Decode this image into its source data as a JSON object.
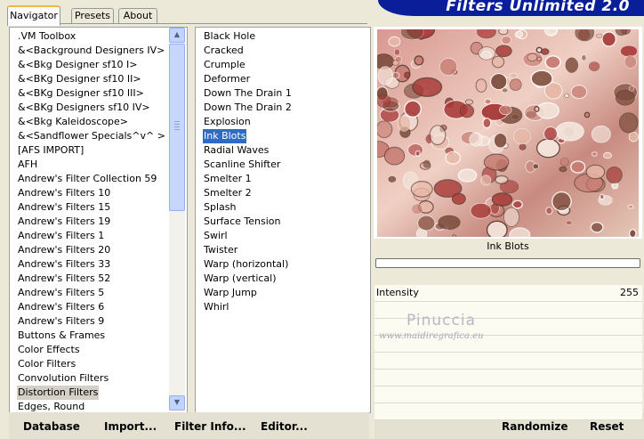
{
  "tabs": [
    "Navigator",
    "Presets",
    "About"
  ],
  "banner": "Filters Unlimited 2.0",
  "categories": [
    ".VM Toolbox",
    "&<Background Designers IV>",
    "&<Bkg Designer sf10 I>",
    "&<BKg Designer sf10 II>",
    "&<BKg Designer sf10 III>",
    "&<BKg Designers sf10 IV>",
    "&<Bkg Kaleidoscope>",
    "&<Sandflower Specials^v^ >",
    "[AFS IMPORT]",
    "AFH",
    "Andrew's Filter Collection 59",
    "Andrew's Filters 10",
    "Andrew's Filters 15",
    "Andrew's Filters 19",
    "Andrew's Filters 1",
    "Andrew's Filters 20",
    "Andrew's Filters 33",
    "Andrew's Filters 52",
    "Andrew's Filters 5",
    "Andrew's Filters 6",
    "Andrew's Filters 9",
    "Buttons & Frames",
    "Color Effects",
    "Color Filters",
    "Convolution Filters",
    "Distortion Filters",
    "Edges, Round"
  ],
  "selected_category": "Distortion Filters",
  "filters": [
    "Black Hole",
    "Cracked",
    "Crumple",
    "Deformer",
    "Down The Drain 1",
    "Down The Drain 2",
    "Explosion",
    "Ink Blots",
    "Radial Waves",
    "Scanline Shifter",
    "Smelter 1",
    "Smelter 2",
    "Splash",
    "Surface Tension",
    "Swirl",
    "Twister",
    "Warp (horizontal)",
    "Warp (vertical)",
    "Warp Jump",
    "Whirl"
  ],
  "selected_filter": "Ink Blots",
  "preview": {
    "effect_name": "Ink Blots"
  },
  "params": [
    {
      "label": "Intensity",
      "value": "255"
    }
  ],
  "watermark": {
    "name": "Pinuccia",
    "url": "www.maidiregrafica.eu"
  },
  "buttons": {
    "database": "Database",
    "import": "Import...",
    "filter_info": "Filter Info...",
    "editor": "Editor...",
    "randomize": "Randomize",
    "reset": "Reset"
  },
  "scroll_arrows": {
    "up": "▲",
    "down": "▼"
  },
  "colors": {
    "banner": "#0a1e9a",
    "selection_blue": "#316ac5",
    "selection_gray": "#d4d0c8",
    "tab_highlight": "#f3b544",
    "preview_tones": [
      "#c87c72",
      "#e8b8a8",
      "#f4e6dc",
      "#7a4a3a",
      "#a83a38"
    ]
  }
}
